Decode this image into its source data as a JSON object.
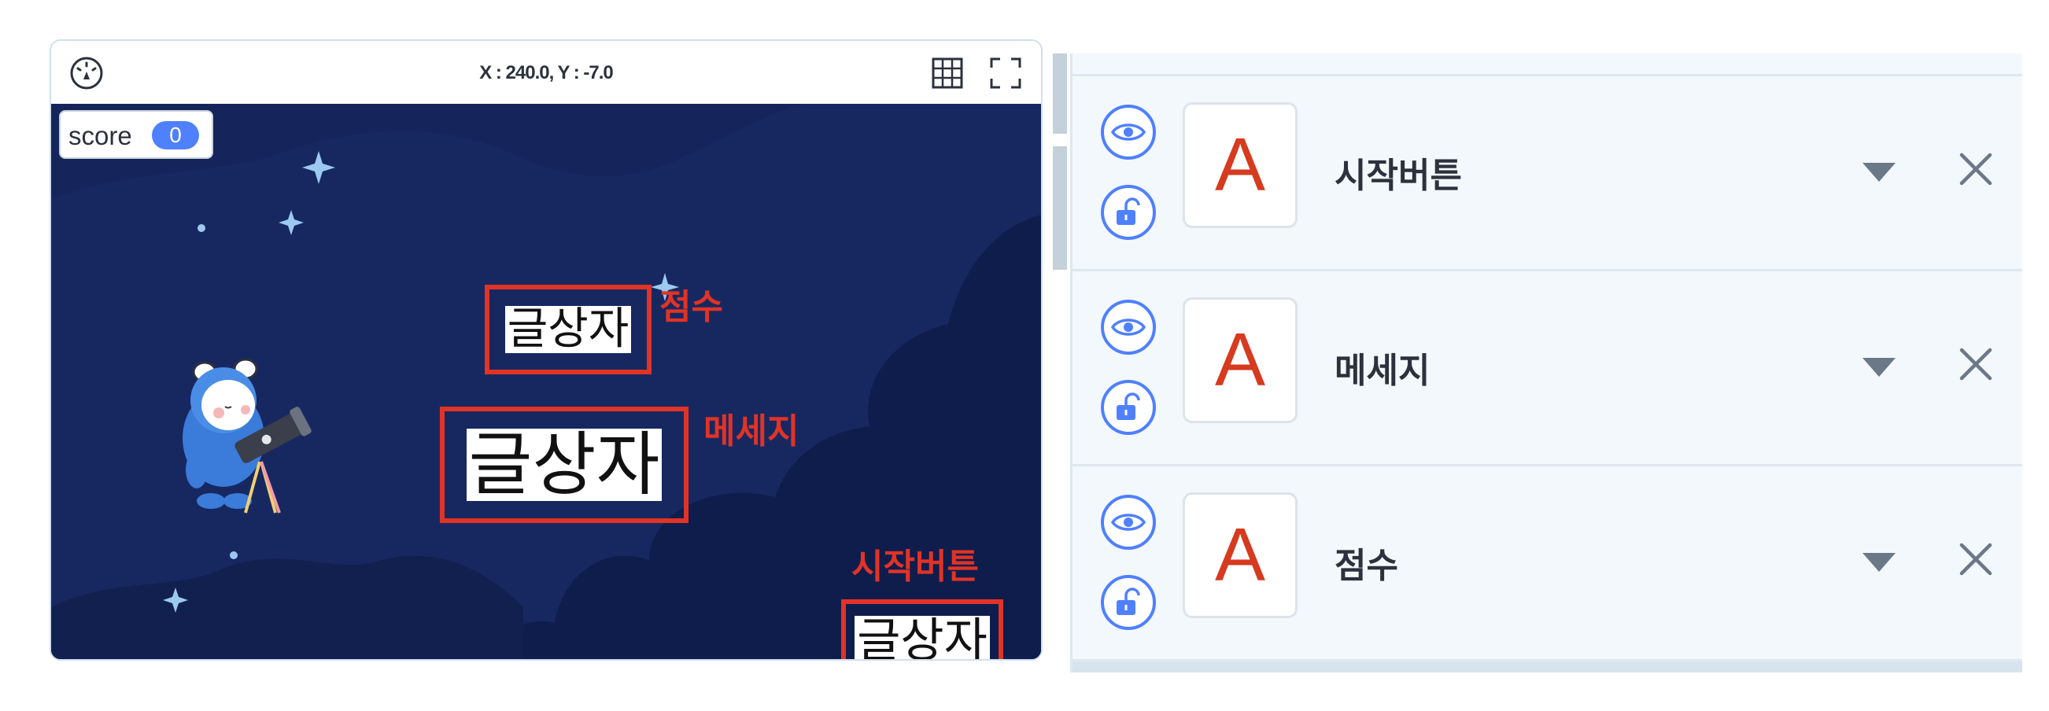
{
  "stage": {
    "coordinates": "X : 240.0, Y : -7.0",
    "icons": {
      "left": "speedometer-icon",
      "grid": "grid-icon",
      "fullscreen": "fullscreen-icon"
    },
    "score_monitor": {
      "label": "score",
      "value": "0"
    },
    "text_sprites": [
      {
        "text": "글상자",
        "annotation": "점수"
      },
      {
        "text": "글상자",
        "annotation": "메세지"
      },
      {
        "text": "글상자",
        "annotation": "시작버튼"
      }
    ]
  },
  "objects": {
    "items": [
      {
        "thumbnail": "A",
        "name": "시작버튼"
      },
      {
        "thumbnail": "A",
        "name": "메세지"
      },
      {
        "thumbnail": "A",
        "name": "점수"
      }
    ]
  },
  "colors": {
    "accent": "#4f80ff",
    "annotation_red": "#e13326",
    "stage_bg": "#15245b",
    "thumbnail_letter": "#d63a1f"
  }
}
